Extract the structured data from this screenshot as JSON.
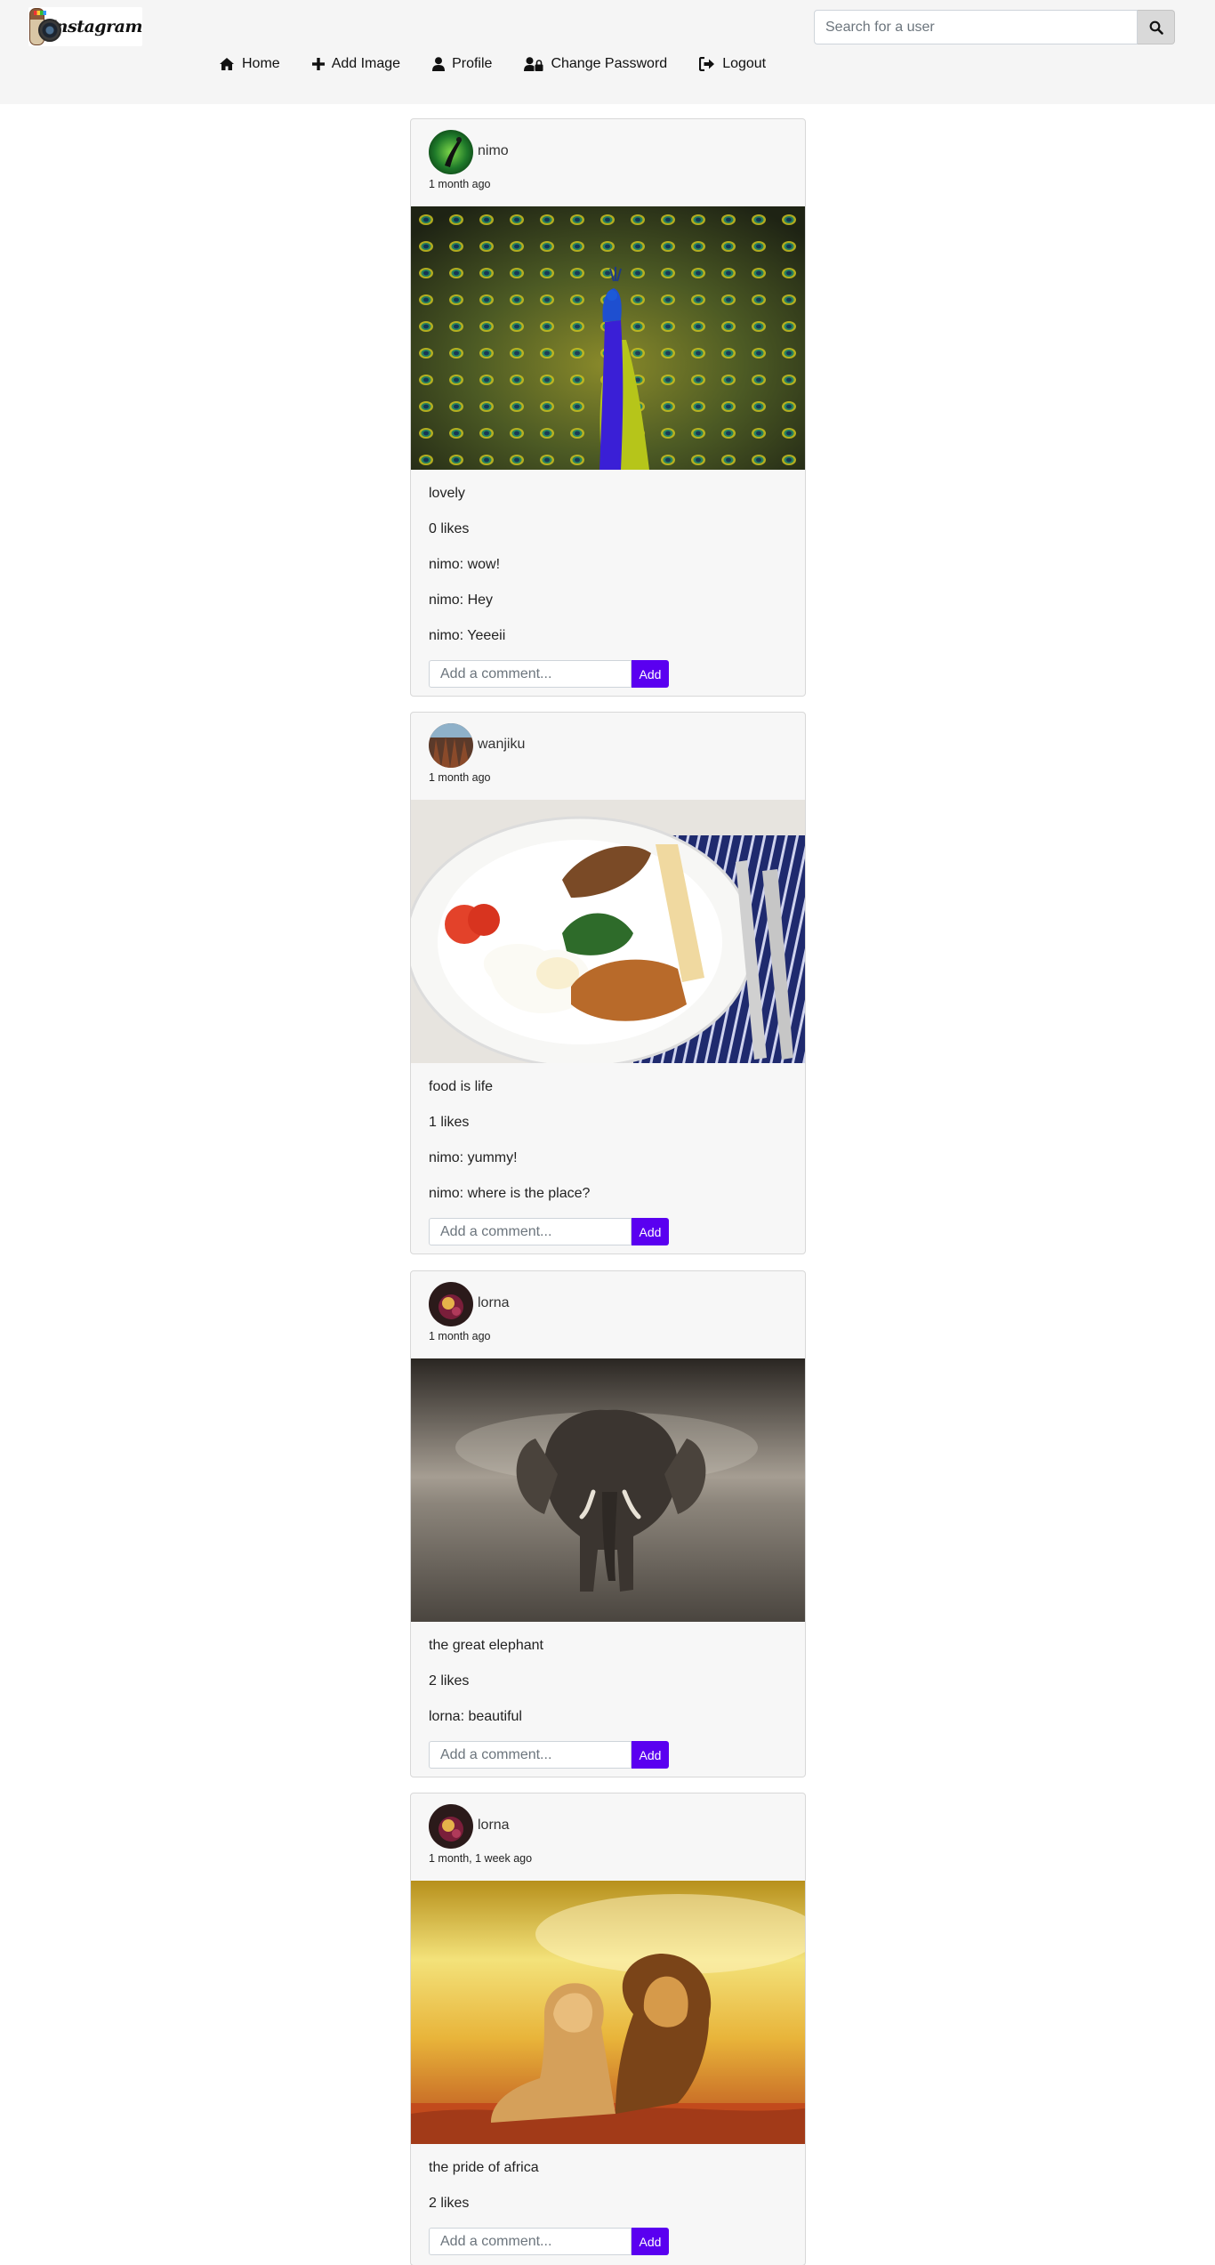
{
  "brand": {
    "name": "Instagram"
  },
  "search": {
    "placeholder": "Search for a user",
    "icon": "search-icon"
  },
  "nav": {
    "home": "Home",
    "add_image": "Add Image",
    "profile": "Profile",
    "change_password": "Change Password",
    "logout": "Logout"
  },
  "colors": {
    "accent": "#5a00f0",
    "navbar_bg": "#f5f5f5",
    "card_bg": "#f7f7f7"
  },
  "posts": [
    {
      "username": "nimo",
      "time": "1 month ago",
      "caption": "lovely",
      "likes": "0 likes",
      "comments": [
        "nimo: wow!",
        "nimo: Hey",
        "nimo: Yeeeii"
      ],
      "comment_placeholder": "Add a comment...",
      "add_label": "Add"
    },
    {
      "username": "wanjiku",
      "time": "1 month ago",
      "caption": "food is life",
      "likes": "1 likes",
      "comments": [
        "nimo: yummy!",
        "nimo: where is the place?"
      ],
      "comment_placeholder": "Add a comment...",
      "add_label": "Add"
    },
    {
      "username": "lorna",
      "time": "1 month ago",
      "caption": "the great elephant",
      "likes": "2 likes",
      "comments": [
        "lorna: beautiful"
      ],
      "comment_placeholder": "Add a comment...",
      "add_label": "Add"
    },
    {
      "username": "lorna",
      "time": "1 month, 1 week ago",
      "caption": "the pride of africa",
      "likes": "2 likes",
      "comments": [],
      "comment_placeholder": "Add a comment...",
      "add_label": "Add"
    }
  ]
}
